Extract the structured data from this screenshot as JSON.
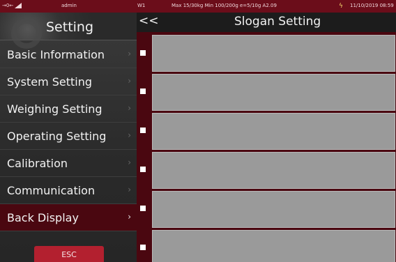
{
  "status_bar": {
    "left_icon": "→0←",
    "user": "admin",
    "weigh_mode": "W1",
    "capacity": "Max 15/30kg  Min 100/200g e=5/10g A2.09",
    "power_icon": "lightning-bolt",
    "datetime": "11/10/2019 08:59"
  },
  "sidebar": {
    "title": "Setting",
    "items": [
      {
        "label": "Basic Information",
        "chevron": "›"
      },
      {
        "label": "System Setting",
        "chevron": "›"
      },
      {
        "label": "Weighing Setting",
        "chevron": "›"
      },
      {
        "label": "Operating Setting",
        "chevron": "›"
      },
      {
        "label": "Calibration",
        "chevron": "›"
      },
      {
        "label": "Communication",
        "chevron": "›"
      },
      {
        "label": "Back Display",
        "chevron": "›",
        "active": true
      }
    ],
    "esc_label": "ESC"
  },
  "main": {
    "back_label": "<<",
    "title": "Slogan Setting",
    "slogan_fields": [
      "",
      "",
      "",
      "",
      "",
      ""
    ]
  },
  "colors": {
    "accent": "#6b0d1a",
    "active_bg": "#4a0710",
    "esc_button": "#b3202f",
    "field_bg": "#9a9a9a"
  }
}
